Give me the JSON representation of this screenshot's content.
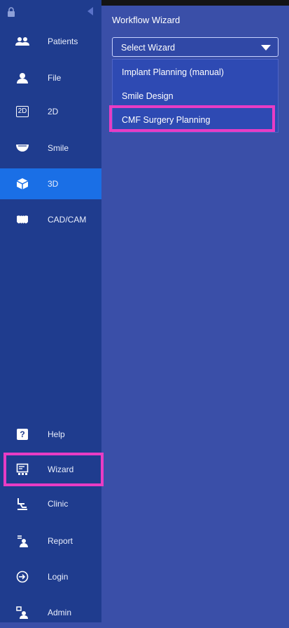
{
  "sidebar": {
    "items": [
      {
        "label": "Patients",
        "icon": "patients-icon"
      },
      {
        "label": "File",
        "icon": "file-icon"
      },
      {
        "label": "2D",
        "icon": "2d-icon",
        "badge": "2D"
      },
      {
        "label": "Smile",
        "icon": "smile-icon"
      },
      {
        "label": "3D",
        "icon": "3d-icon"
      },
      {
        "label": "CAD/CAM",
        "icon": "cadcam-icon"
      },
      {
        "label": "Help",
        "icon": "help-icon",
        "badge": "?"
      },
      {
        "label": "Wizard",
        "icon": "wizard-icon"
      },
      {
        "label": "Clinic",
        "icon": "clinic-icon"
      },
      {
        "label": "Report",
        "icon": "report-icon"
      },
      {
        "label": "Login",
        "icon": "login-icon"
      },
      {
        "label": "Admin",
        "icon": "admin-icon"
      }
    ],
    "active": "3D",
    "highlighted": "Wizard"
  },
  "panel": {
    "title": "Workflow Wizard",
    "select_value": "Select Wizard",
    "options": [
      {
        "label": "Implant Planning (manual)"
      },
      {
        "label": "Smile Design"
      },
      {
        "label": "CMF Surgery Planning"
      }
    ],
    "highlighted_option": "CMF Surgery Planning"
  },
  "colors": {
    "sidebar_bg": "#1f3c8e",
    "panel_bg": "#3a4fa8",
    "active_item": "#1a6fe6",
    "highlight": "#e83cc4"
  }
}
